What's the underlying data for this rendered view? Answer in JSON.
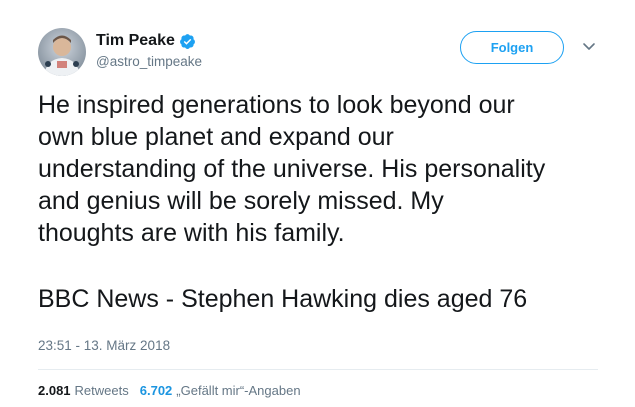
{
  "author": {
    "display_name": "Tim Peake",
    "handle": "@astro_timpeake",
    "verified": true
  },
  "follow_button": {
    "label": "Folgen"
  },
  "tweet": {
    "text_lines": [
      "He inspired generations to look beyond our",
      "own blue planet and expand our",
      "understanding of the universe. His personality",
      "and genius will be sorely missed. My",
      "thoughts are with his family."
    ],
    "link_text": "BBC News - Stephen Hawking dies aged 76",
    "timestamp": "23:51 - 13. März 2018"
  },
  "stats": {
    "retweets_count": "2.081",
    "retweets_label": "Retweets",
    "likes_count": "6.702",
    "likes_label": "„Gefällt mir“-Angaben"
  },
  "colors": {
    "brand_blue": "#1da1f2",
    "text_primary": "#14171a",
    "text_secondary": "#657786",
    "divider": "#e6ecf0"
  },
  "icons": {
    "verified": "verified-badge-icon",
    "caret": "chevron-down-icon"
  }
}
